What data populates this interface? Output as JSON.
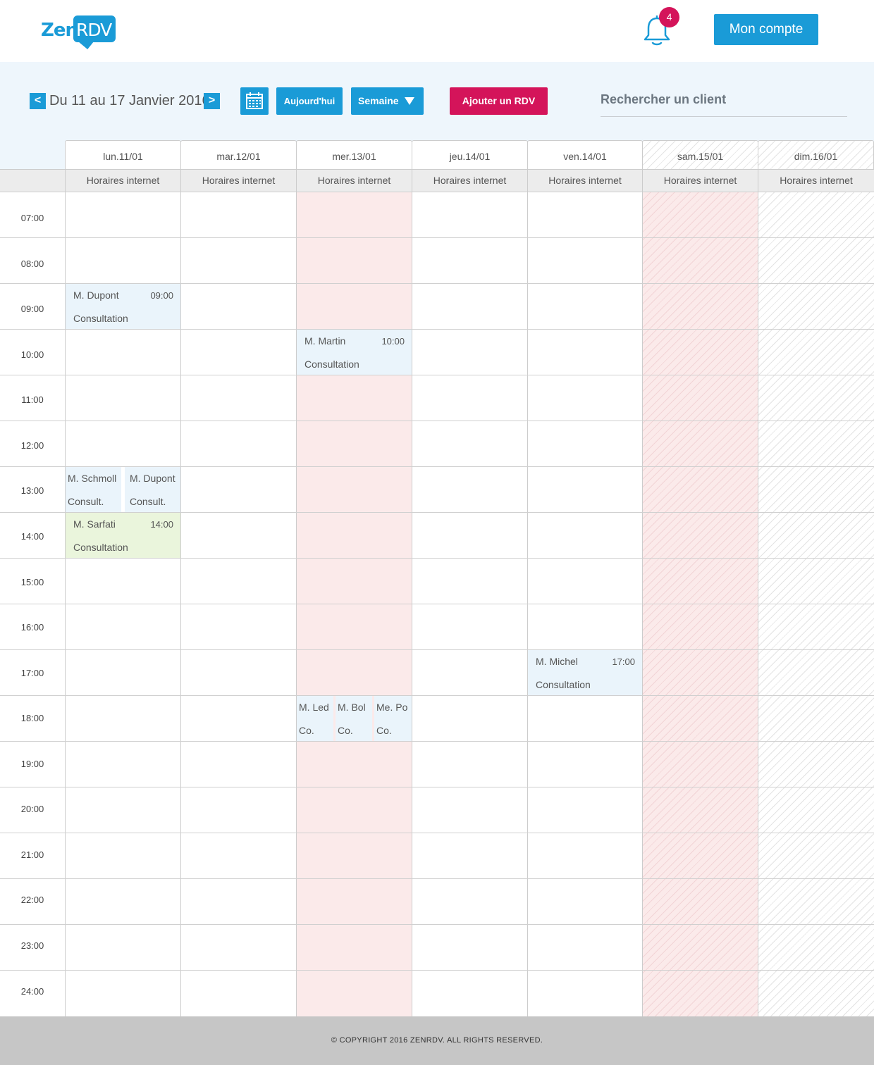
{
  "header": {
    "logo_zen": "Zen",
    "logo_rdv": "RDV",
    "notification_count": "4",
    "account_label": "Mon compte"
  },
  "toolbar": {
    "prev_label": "<",
    "next_label": ">",
    "date_range": "Du 11 au 17 Janvier 2016",
    "today_label": "Aujourd'hui",
    "view_label": "Semaine",
    "add_label": "Ajouter un RDV",
    "search_placeholder": "Rechercher un client"
  },
  "days": [
    {
      "label": "lun.11/01",
      "sub": "Horaires internet"
    },
    {
      "label": "mar.12/01",
      "sub": "Horaires internet"
    },
    {
      "label": "mer.13/01",
      "sub": "Horaires internet"
    },
    {
      "label": "jeu.14/01",
      "sub": "Horaires internet"
    },
    {
      "label": "ven.14/01",
      "sub": "Horaires internet"
    },
    {
      "label": "sam.15/01",
      "sub": "Horaires internet"
    },
    {
      "label": "dim.16/01",
      "sub": "Horaires internet"
    }
  ],
  "hours": [
    "07:00",
    "08:00",
    "09:00",
    "10:00",
    "11:00",
    "12:00",
    "13:00",
    "14:00",
    "15:00",
    "16:00",
    "17:00",
    "18:00",
    "19:00",
    "20:00",
    "21:00",
    "22:00",
    "23:00",
    "24:00"
  ],
  "appointments": [
    {
      "name": "M. Dupont",
      "time": "09:00",
      "type": "Consultation"
    },
    {
      "name": "M. Martin",
      "time": "10:00",
      "type": "Consultation"
    },
    {
      "name": "M. Schmoll",
      "type": "Consult."
    },
    {
      "name": "M. Dupont",
      "type": "Consult."
    },
    {
      "name": "M. Sarfati",
      "time": "14:00",
      "type": "Consultation"
    },
    {
      "name": "M. Michel",
      "time": "17:00",
      "type": "Consultation"
    },
    {
      "name": "M. Led",
      "type": "Co."
    },
    {
      "name": "M. Bol",
      "type": "Co."
    },
    {
      "name": "Me. Po",
      "type": "Co."
    }
  ],
  "colors": {
    "primary": "#1a9bd7",
    "accent": "#d4145a",
    "closed": "#fbeaea",
    "appointment": "#eaf4fb",
    "appointment_confirmed": "#eaf5dc"
  },
  "footer": {
    "copyright": "© COPYRIGHT 2016 ZENRDV. ALL RIGHTS RESERVED."
  }
}
